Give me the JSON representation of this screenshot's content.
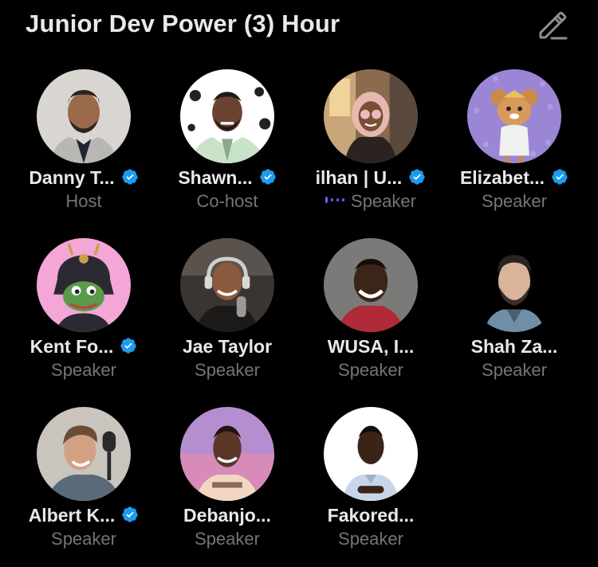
{
  "space": {
    "title": "Junior Dev Power (3) Hour",
    "edit_icon": "pencil-edit-icon"
  },
  "colors": {
    "background": "#000000",
    "text_primary": "#e7e9ea",
    "text_secondary": "#71767b",
    "verified_badge": "#1d9bf0",
    "speaking_indicator": "#7856ff"
  },
  "participants": [
    {
      "name": "Danny T...",
      "role": "Host",
      "verified": true,
      "speaking": false
    },
    {
      "name": "Shawn...",
      "role": "Co-host",
      "verified": true,
      "speaking": false
    },
    {
      "name": "ilhan | U...",
      "role": "Speaker",
      "verified": true,
      "speaking": true
    },
    {
      "name": "Elizabet...",
      "role": "Speaker",
      "verified": true,
      "speaking": false
    },
    {
      "name": "Kent Fo...",
      "role": "Speaker",
      "verified": true,
      "speaking": false
    },
    {
      "name": "Jae Taylor",
      "role": "Speaker",
      "verified": false,
      "speaking": false
    },
    {
      "name": "WUSA, I...",
      "role": "Speaker",
      "verified": false,
      "speaking": false
    },
    {
      "name": "Shah Za...",
      "role": "Speaker",
      "verified": false,
      "speaking": false
    },
    {
      "name": "Albert K...",
      "role": "Speaker",
      "verified": true,
      "speaking": false
    },
    {
      "name": "Debanjo...",
      "role": "Speaker",
      "verified": false,
      "speaking": false
    },
    {
      "name": "Fakored...",
      "role": "Speaker",
      "verified": false,
      "speaking": false
    }
  ]
}
